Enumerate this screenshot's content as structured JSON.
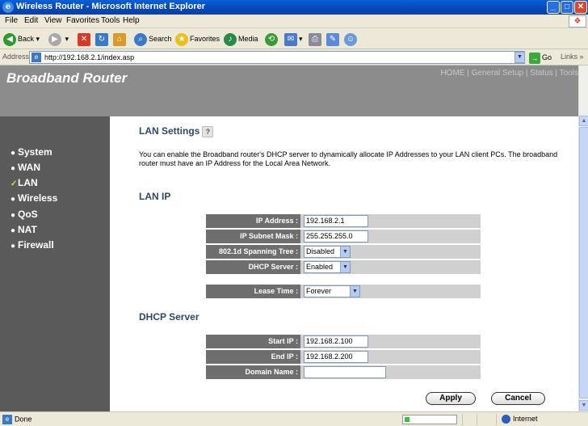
{
  "window": {
    "title": "Wireless Router - Microsoft Internet Explorer"
  },
  "menubar": {
    "items": [
      "File",
      "Edit",
      "View",
      "Favorites",
      "Tools",
      "Help"
    ]
  },
  "toolbar": {
    "back": "Back",
    "search": "Search",
    "favorites": "Favorites",
    "media": "Media"
  },
  "address": {
    "label": "Address",
    "url": "http://192.168.2.1/index.asp",
    "go": "Go",
    "links": "Links"
  },
  "header": {
    "brand": "Broadband Router",
    "nav": [
      "HOME",
      "General Setup",
      "Status",
      "Tools"
    ],
    "sep": "|"
  },
  "sidebar": {
    "items": [
      {
        "label": "System",
        "bullet": "●"
      },
      {
        "label": "WAN",
        "bullet": "●"
      },
      {
        "label": "LAN",
        "bullet": "✓"
      },
      {
        "label": "Wireless",
        "bullet": "●"
      },
      {
        "label": "QoS",
        "bullet": "●"
      },
      {
        "label": "NAT",
        "bullet": "●"
      },
      {
        "label": "Firewall",
        "bullet": "●"
      }
    ]
  },
  "content": {
    "title": "LAN Settings",
    "description": "You can enable the Broadband router's DHCP server to dynamically allocate IP Addresses to your LAN client PCs. The broadband router must have an IP Address for the Local Area Network.",
    "lan_ip_heading": "LAN IP",
    "dhcp_heading": "DHCP Server",
    "lan_rows": [
      {
        "label": "IP Address :",
        "value": "192.168.2.1"
      },
      {
        "label": "IP Subnet Mask :",
        "value": "255.255.255.0"
      },
      {
        "label": "802.1d Spanning Tree :",
        "value": "Disabled"
      },
      {
        "label": "DHCP Server :",
        "value": "Enabled"
      }
    ],
    "lease": {
      "label": "Lease Time :",
      "value": "Forever"
    },
    "dhcp_rows": [
      {
        "label": "Start IP :",
        "value": "192.168.2.100"
      },
      {
        "label": "End IP :",
        "value": "192.168.2.200"
      },
      {
        "label": "Domain Name :",
        "value": ""
      }
    ],
    "apply": "Apply",
    "cancel": "Cancel"
  },
  "status": {
    "text": "Done",
    "zone": "Internet",
    "progress": 0.1
  },
  "colors": {
    "header": "#8c8c8c",
    "sidebar": "#5a5a5a",
    "label_cell": "#6e6e6e",
    "value_cell": "#d0d0d0",
    "heading": "#2e4868"
  }
}
